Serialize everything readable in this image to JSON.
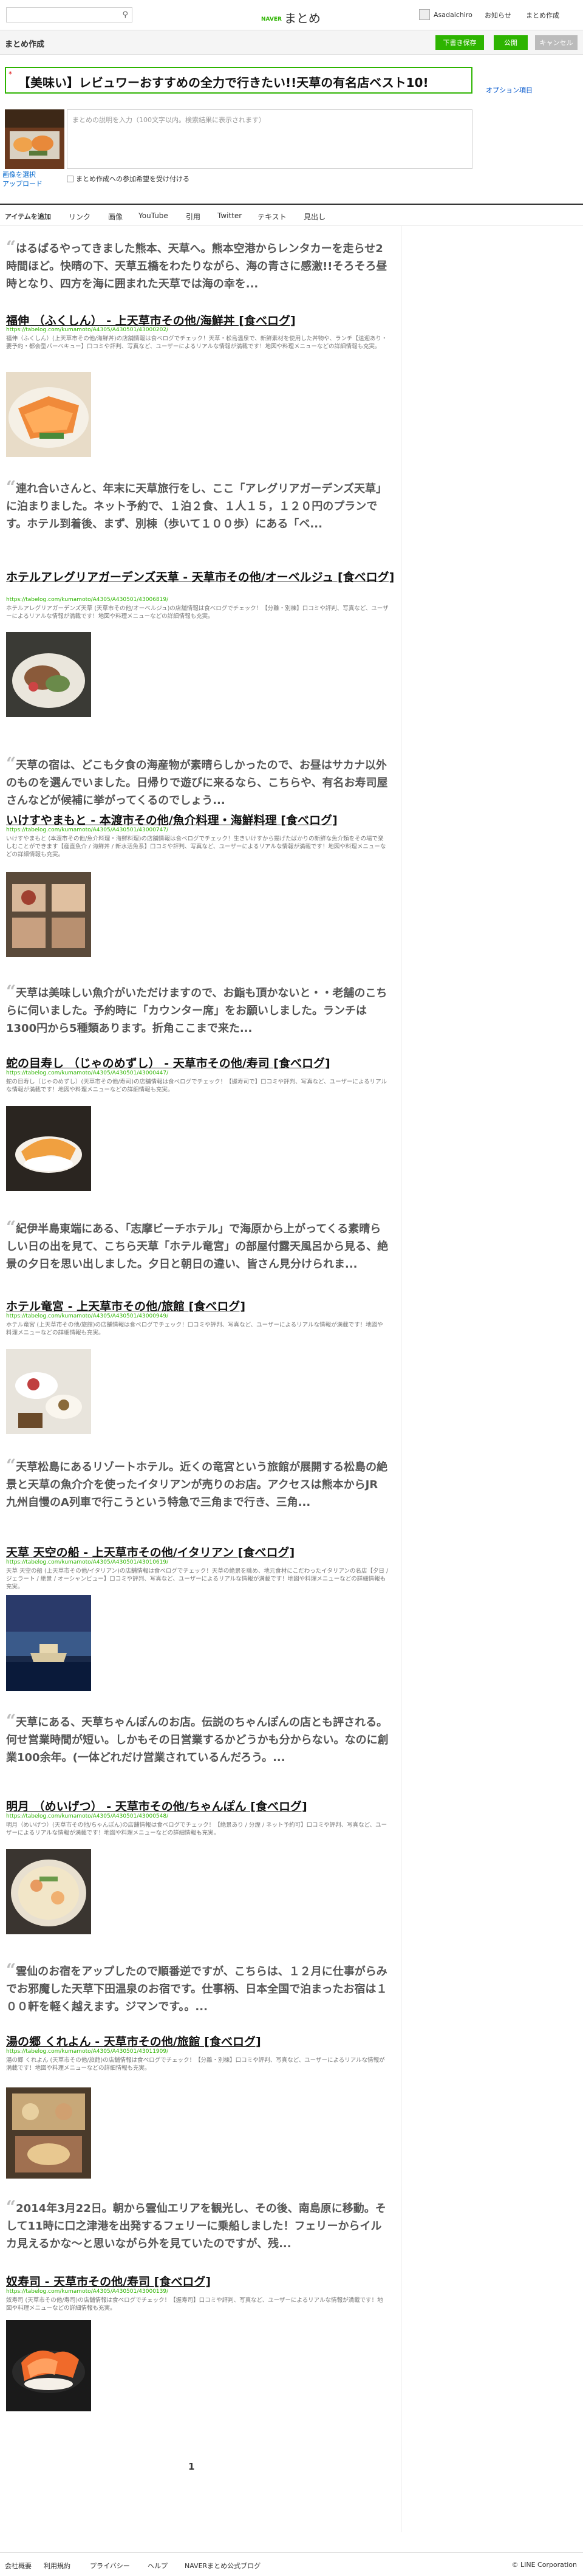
{
  "header": {
    "logo_brand": "NAVER",
    "logo_text": "まとめ",
    "username": "Asadaichiro",
    "notifications": "お知らせ",
    "create": "まとめ作成"
  },
  "editor": {
    "title": "まとめ作成",
    "save_button": "下書き保存",
    "publish_button": "公開",
    "cancel_button": "キャンセル",
    "matome_title": "【美味い】レビュワーおすすめの全力で行きたい!!天草の有名店ベスト10!",
    "options_link": "オプション項目",
    "description_placeholder": "まとめの説明を入力（100文字以内。検索結果に表示されます）",
    "thumb_links": [
      "画像を選択",
      "アップロード"
    ],
    "checkbox_label": "まとめ作成への参加希望を受け付ける"
  },
  "tabs": [
    "アイテムを追加",
    "リンク",
    "画像",
    "YouTube",
    "引用",
    "Twitter",
    "テキスト",
    "見出し"
  ],
  "items": [
    {
      "quote": "はるばるやってきました熊本、天草へ。熊本空港からレンタカーを走らせ2時間ほど。快晴の下、天草五橋をわたりながら、海の青さに感激!!そろそろ昼時となり、四方を海に囲まれた天草では海の幸を...",
      "title": "福伸 （ふくしん） - 上天草市その他/海鮮丼 [食べログ]",
      "url": "https://tabelog.com/kumamoto/A4305/A430501/43000202/",
      "desc": "福伸（ふくしん）(上天草市その他/海鮮丼)の店舗情報は食べログでチェック！天草・松島温泉で、新鮮素材を使用した丼物や、ランチ【送迎あり・要予約・都会型バーベキュー】口コミや評判、写真など、ユーザーによるリアルな情報が満載です！地図や料理メニューなどの詳細情報も充実。"
    },
    {
      "quote": "連れ合いさんと、年末に天草旅行をし、ここ「アレグリアガーデンズ天草」に泊まりました。ネット予約で、１泊２食、１人１５，１２０円のプランです。ホテル到着後、まず、別棟（歩いて１００歩）にある「ベ...",
      "title": "ホテルアレグリアガーデンズ天草 - 天草市その他/オーベルジュ [食べログ]",
      "url": "https://tabelog.com/kumamoto/A4305/A430501/43006819/",
      "desc": "ホテルアレグリアガーデンズ天草 (天草市その他/オーベルジュ)の店舗情報は食べログでチェック！【分離・別棟】口コミや評判、写真など、ユーザーによるリアルな情報が満載です！地図や料理メニューなどの詳細情報も充実。"
    },
    {
      "quote": "天草の宿は、どこも夕食の海産物が素晴らしかったので、お昼はサカナ以外のものを選んでいました。日帰りで遊びに来るなら、こちらや、有名お寿司屋さんなどが候補に挙がってくるのでしょう...",
      "title": "いけすやまもと - 本渡市その他/魚介料理・海鮮料理 [食べログ]",
      "url": "https://tabelog.com/kumamoto/A4305/A430501/43000747/",
      "desc": "いけすやまもと (本渡市その他/魚介料理・海鮮料理)の店舗情報は食べログでチェック！生きいけすから揚げたばかりの新鮮な魚介類をその場で楽しむことができます【産直魚介 / 海鮮丼 / 新水活魚系】口コミや評判、写真など、ユーザーによるリアルな情報が満載です！地図や料理メニューなどの詳細情報も充実。"
    },
    {
      "quote": "天草は美味しい魚介がいただけますので、お鮨も頂かないと・・老舗のこちらに伺いました。予約時に「カウンター席」をお願いしました。ランチは1300円から5種類あります。折角ここまで来た...",
      "title": "蛇の目寿し （じゃのめずし） - 天草市その他/寿司 [食べログ]",
      "url": "https://tabelog.com/kumamoto/A4305/A430501/43000447/",
      "desc": "蛇の目寿し（じゃのめずし）(天草市その他/寿司)の店舗情報は食べログでチェック！【握寿司で】口コミや評判、写真など、ユーザーによるリアルな情報が満載です！地図や料理メニューなどの詳細情報も充実。"
    },
    {
      "quote": "紀伊半島東端にある、「志摩ビーチホテル」で海原から上がってくる素晴らしい日の出を見て、こちら天草「ホテル竜宮」の部屋付露天風呂から見る、絶景の夕日を思い出しました。夕日と朝日の違い、皆さん見分けられま...",
      "title": "ホテル竜宮 - 上天草市その他/旅館 [食べログ]",
      "url": "https://tabelog.com/kumamoto/A4305/A430501/43000949/",
      "desc": "ホテル竜宮 (上天草市その他/旅館)の店舗情報は食べログでチェック！口コミや評判、写真など、ユーザーによるリアルな情報が満載です！地図や料理メニューなどの詳細情報も充実。"
    },
    {
      "quote": "天草松島にあるリゾートホテル。近くの竜宮という旅館が展開する松島の絶景と天草の魚介介を使ったイタリアンが売りのお店。アクセスは熊本からJR九州自慢のA列車で行こうという特急で三角まで行き、三角...",
      "title": "天草 天空の船 - 上天草市その他/イタリアン [食べログ]",
      "url": "https://tabelog.com/kumamoto/A4305/A430501/43010619/",
      "desc": "天草 天空の船 (上天草市その他/イタリアン)の店舗情報は食べログでチェック！天草の絶景を眺め、地元食材にこだわったイタリアンの名店【夕日 / ジェラート / 絶景 / オーシャンビュー】口コミや評判、写真など、ユーザーによるリアルな情報が満載です！地図や料理メニューなどの詳細情報も充実。"
    },
    {
      "quote": "天草にある、天草ちゃんぽんのお店。伝説のちゃんぽんの店とも評される。何せ営業時間が短い。しかもその日営業するかどうかも分からない。なのに創業100余年。(一体どれだけ営業されているんだろう。...",
      "title": "明月 （めいげつ） - 天草市その他/ちゃんぽん [食べログ]",
      "url": "https://tabelog.com/kumamoto/A4305/A430501/43000548/",
      "desc": "明月（めいげつ）(天草市その他/ちゃんぽん)の店舗情報は食べログでチェック！【絶景あり / 分煙 / ネット予約可】口コミや評判、写真など、ユーザーによるリアルな情報が満載です！地図や料理メニューなどの詳細情報も充実。"
    },
    {
      "quote": "雲仙のお宿をアップしたので順番逆ですが、こちらは、１２月に仕事がらみでお邪魔した天草下田温泉のお宿です。仕事柄、日本全国で泊まったお宿は１００軒を軽く越えます。ジマンです。。...",
      "title": "湯の郷 くれよん - 天草市その他/旅館 [食べログ]",
      "url": "https://tabelog.com/kumamoto/A4305/A430501/43011909/",
      "desc": "湯の郷 くれよん (天草市その他/旅館)の店舗情報は食べログでチェック！【分離・別棟】口コミや評判、写真など、ユーザーによるリアルな情報が満載です！地図や料理メニューなどの詳細情報も充実。"
    },
    {
      "quote": "2014年3月22日。朝から雲仙エリアを観光し、その後、南島原に移動。そして11時に口之津港を出発するフェリーに乗船しました！フェリーからイルカ見えるかな～と思いながら外を見ていたのですが、残...",
      "title": "奴寿司 - 天草市その他/寿司 [食べログ]",
      "url": "https://tabelog.com/kumamoto/A4305/A430501/43000139/",
      "desc": "奴寿司 (天草市その他/寿司)の店舗情報は食べログでチェック！【握寿司】口コミや評判、写真など、ユーザーによるリアルな情報が満載です！地図や料理メニューなどの詳細情報も充実。"
    }
  ],
  "pager": {
    "current": "1"
  },
  "footer": {
    "links": [
      "会社概要",
      "利用規約",
      "プライバシー",
      "ヘルプ",
      "NAVERまとめ公式ブログ"
    ],
    "copyright": "© LINE Corporation"
  },
  "colors": {
    "accent": "#2db400",
    "link": "#0055cc",
    "cancel": "#bbbbbb"
  }
}
